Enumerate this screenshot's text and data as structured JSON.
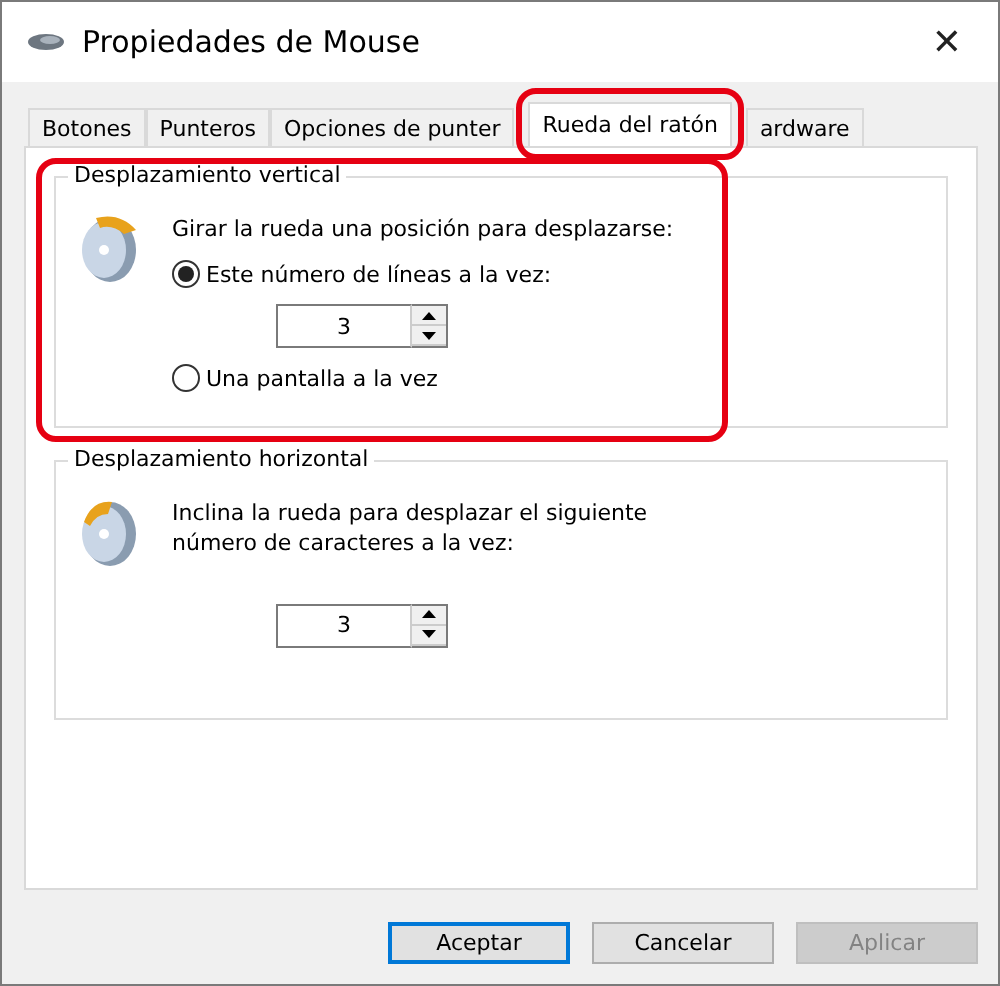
{
  "window": {
    "title": "Propiedades de Mouse",
    "close": "✕"
  },
  "tabs": [
    {
      "label": "Botones",
      "selected": false,
      "highlighted": false
    },
    {
      "label": "Punteros",
      "selected": false,
      "highlighted": false
    },
    {
      "label": "Opciones de punter",
      "selected": false,
      "highlighted": false
    },
    {
      "label": "Rueda del ratón",
      "selected": true,
      "highlighted": true
    },
    {
      "label": "ardware",
      "selected": false,
      "highlighted": false
    }
  ],
  "groups": [
    {
      "kind": "radio-options",
      "title": "Desplazamiento vertical",
      "highlighted": true,
      "prompt": "Girar la rueda una posición para desplazarse:",
      "options": [
        {
          "label": "Este número de líneas a la vez:",
          "selected": true,
          "spinner": {
            "value": "3"
          }
        },
        {
          "label": "Una pantalla a la vez",
          "selected": false
        }
      ]
    },
    {
      "kind": "spinner-only",
      "title": "Desplazamiento horizontal",
      "highlighted": false,
      "prompt": "Inclina la rueda para desplazar el siguiente número de caracteres a la vez:",
      "spinner": {
        "value": "3"
      }
    }
  ],
  "buttons": [
    {
      "label": "Aceptar",
      "default": true,
      "disabled": false
    },
    {
      "label": "Cancelar",
      "default": false,
      "disabled": false
    },
    {
      "label": "Aplicar",
      "default": false,
      "disabled": true
    }
  ]
}
